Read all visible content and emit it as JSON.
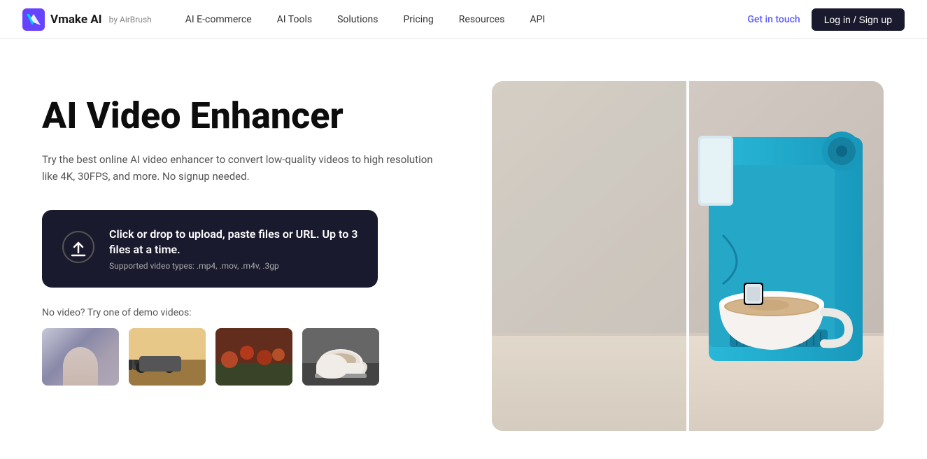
{
  "navbar": {
    "logo_text": "Vmake AI",
    "logo_by": "by AirBrush",
    "nav_items": [
      {
        "label": "AI E-commerce"
      },
      {
        "label": "AI Tools"
      },
      {
        "label": "Solutions"
      },
      {
        "label": "Pricing"
      },
      {
        "label": "Resources"
      },
      {
        "label": "API"
      }
    ],
    "get_in_touch": "Get in touch",
    "login_label": "Log in / Sign up"
  },
  "hero": {
    "title": "AI Video Enhancer",
    "subtitle": "Try the best online AI video enhancer to convert low-quality videos to high resolution like 4K, 30FPS, and more. No signup needed.",
    "upload": {
      "main_text": "Click or drop to upload, paste files or URL. Up to 3 files at a time.",
      "sub_text": "Supported video types: .mp4, .mov, .m4v, .3gp"
    },
    "demo_label": "No video? Try one of demo videos:",
    "demo_thumbs": [
      {
        "id": "thumb-1",
        "desc": "Person face video"
      },
      {
        "id": "thumb-2",
        "desc": "Car in desert video"
      },
      {
        "id": "thumb-3",
        "desc": "Nature flowers video"
      },
      {
        "id": "thumb-4",
        "desc": "Coffee cup video"
      }
    ]
  },
  "colors": {
    "accent": "#5c5cff",
    "dark_bg": "#1a1a2e",
    "text_primary": "#0d0d0d",
    "text_secondary": "#555"
  }
}
